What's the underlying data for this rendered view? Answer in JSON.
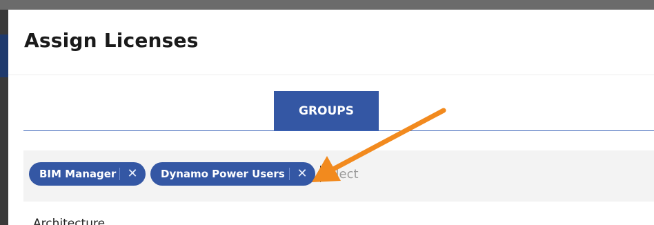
{
  "modal": {
    "title": "Assign Licenses"
  },
  "tabs": [
    {
      "label": "GROUPS",
      "active": true
    }
  ],
  "group_select": {
    "selected": [
      {
        "label": "BIM Manager",
        "remove_icon": "x-icon"
      },
      {
        "label": "Dynamo Power Users",
        "remove_icon": "x-icon"
      }
    ],
    "placeholder": "Select",
    "first_option_partial": "Architecture"
  },
  "colors": {
    "accent_blue": "#3457a4",
    "arrow_orange": "#f28a1e"
  }
}
